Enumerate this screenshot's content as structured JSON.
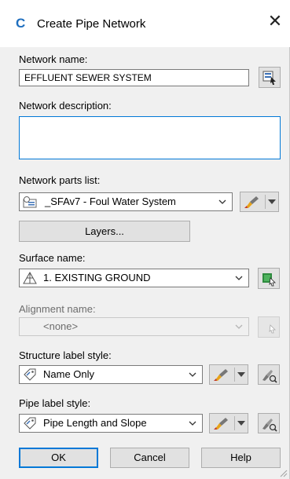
{
  "dialog": {
    "title": "Create Pipe Network",
    "app_icon_letter": "C",
    "close_glyph": "✕"
  },
  "network_name": {
    "label": "Network name:",
    "value": "EFFLUENT SEWER SYSTEM",
    "picker_icon": "name-template-icon"
  },
  "network_description": {
    "label": "Network description:",
    "value": ""
  },
  "parts_list": {
    "label": "Network parts list:",
    "value": "_SFAv7 - Foul Water System",
    "icon": "parts-list-icon",
    "edit_icon": "edit-style-icon"
  },
  "layers_button": {
    "label": "Layers..."
  },
  "surface": {
    "label": "Surface name:",
    "value": "1. EXISTING GROUND",
    "icon": "surface-icon",
    "pick_icon": "pick-from-drawing-icon"
  },
  "alignment": {
    "label": "Alignment name:",
    "value": "<none>",
    "pick_icon": "pick-from-drawing-icon"
  },
  "structure_label": {
    "label": "Structure label style:",
    "value": "Name Only",
    "icon": "label-style-icon",
    "edit_icon": "edit-style-icon",
    "preview_icon": "preview-icon"
  },
  "pipe_label": {
    "label": "Pipe label style:",
    "value": "Pipe Length and Slope",
    "icon": "label-style-icon",
    "edit_icon": "edit-style-icon",
    "preview_icon": "preview-icon"
  },
  "buttons": {
    "ok": "OK",
    "cancel": "Cancel",
    "help": "Help"
  },
  "colors": {
    "focus_blue": "#0078d7",
    "dialog_bg": "#f0f0f0",
    "surface_green": "#2e8b3e"
  }
}
